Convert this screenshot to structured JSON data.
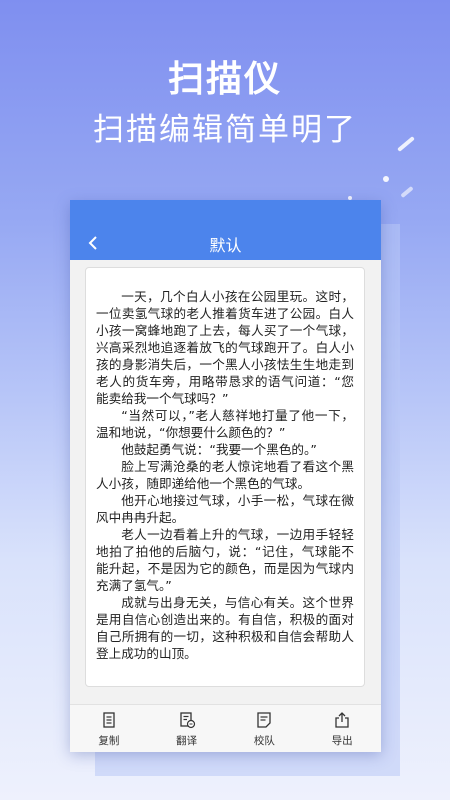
{
  "hero": {
    "title": "扫描仪",
    "subtitle": "扫描编辑简单明了"
  },
  "window": {
    "title": "默认",
    "back_icon": "back-arrow-icon"
  },
  "document": {
    "paragraphs": [
      "一天，几个白人小孩在公园里玩。这时，一位卖氢气球的老人推着货车进了公园。白人小孩一窝蜂地跑了上去，每人买了一个气球，兴高采烈地追逐着放飞的气球跑开了。白人小孩的身影消失后，一个黑人小孩怯生生地走到老人的货车旁，用略带恳求的语气问道：“您能卖给我一个气球吗？”",
      "“当然可以，”老人慈祥地打量了他一下，温和地说，“你想要什么颜色的？”",
      "他鼓起勇气说：“我要一个黑色的。”",
      "脸上写满沧桑的老人惊诧地看了看这个黑人小孩，随即递给他一个黑色的气球。",
      "他开心地接过气球，小手一松，气球在微风中冉冉升起。",
      "老人一边看着上升的气球，一边用手轻轻地拍了拍他的后脑勺，说：“记住，气球能不能升起，不是因为它的颜色，而是因为气球内充满了氢气。”",
      "成就与出身无关，与信心有关。这个世界是用自信心创造出来的。有自信，积极的面对自己所拥有的一切，这种积极和自信会帮助人登上成功的山顶。"
    ]
  },
  "toolbar": {
    "items": [
      {
        "label": "复制",
        "icon": "copy-icon"
      },
      {
        "label": "翻译",
        "icon": "translate-icon"
      },
      {
        "label": "校队",
        "icon": "proofread-icon"
      },
      {
        "label": "导出",
        "icon": "export-icon"
      }
    ]
  },
  "colors": {
    "accent": "#4c84ec",
    "background_top": "#7f8ff0",
    "background_bottom": "#eef1fd"
  }
}
